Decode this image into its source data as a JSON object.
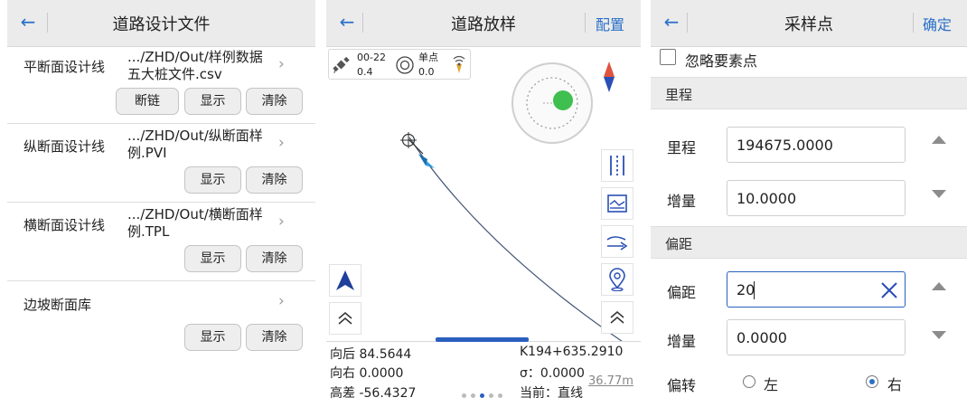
{
  "colors": {
    "accent": "#2a6fc9",
    "gps_dot": "#3fbf4f",
    "header_bg": "#ebebeb"
  },
  "panel1": {
    "header": {
      "back_icon": "←",
      "title": "道路设计文件"
    },
    "rows": [
      {
        "label": "平断面设计线",
        "path_line1": ".../ZHD/Out/样例数据",
        "path_line2": "五大桩文件.csv",
        "chevron": "›",
        "buttons": [
          "断链",
          "显示",
          "清除"
        ]
      },
      {
        "label": "纵断面设计线",
        "path_line1": ".../ZHD/Out/纵断面样",
        "path_line2": "例.PVI",
        "chevron": "›",
        "buttons": [
          "显示",
          "清除"
        ]
      },
      {
        "label": "横断面设计线",
        "path_line1": ".../ZHD/Out/横断面样",
        "path_line2": "例.TPL",
        "chevron": "›",
        "buttons": [
          "显示",
          "清除"
        ]
      },
      {
        "label": "边坡断面库",
        "chevron": "›",
        "buttons": [
          "显示",
          "清除"
        ]
      }
    ]
  },
  "panel2": {
    "header": {
      "back_icon": "←",
      "title": "道路放样",
      "config_label": "配置"
    },
    "status": {
      "sat_text": "00-22",
      "sat_value": "0.4",
      "mode_text": "单点",
      "mode_value": "0.0"
    },
    "tool_icons": [
      "vertical-lines-icon",
      "profile-chart-icon",
      "arrow-right-icon",
      "location-pin-icon",
      "chevron-up-double-icon"
    ],
    "readout": {
      "back_dist": "向后 84.5644",
      "right_dist": "向右 0.0000",
      "height_diff": "高差 -56.4327",
      "station": "K194+635.2910",
      "sigma": "σ：0.0000",
      "current": "当前：直线"
    },
    "scale": "36.77m"
  },
  "panel3": {
    "header": {
      "back_icon": "←",
      "title": "采样点",
      "confirm_label": "确定"
    },
    "ignore_label": "忽略要素点",
    "mileage_section": "里程",
    "mileage_label": "里程",
    "mileage_value": "194675.0000",
    "mileage_inc_label": "增量",
    "mileage_inc_value": "10.0000",
    "offset_section": "偏距",
    "offset_label": "偏距",
    "offset_value": "20",
    "offset_inc_label": "增量",
    "offset_inc_value": "0.0000",
    "deflect_label": "偏转",
    "left_label": "左",
    "right_label": "右"
  }
}
